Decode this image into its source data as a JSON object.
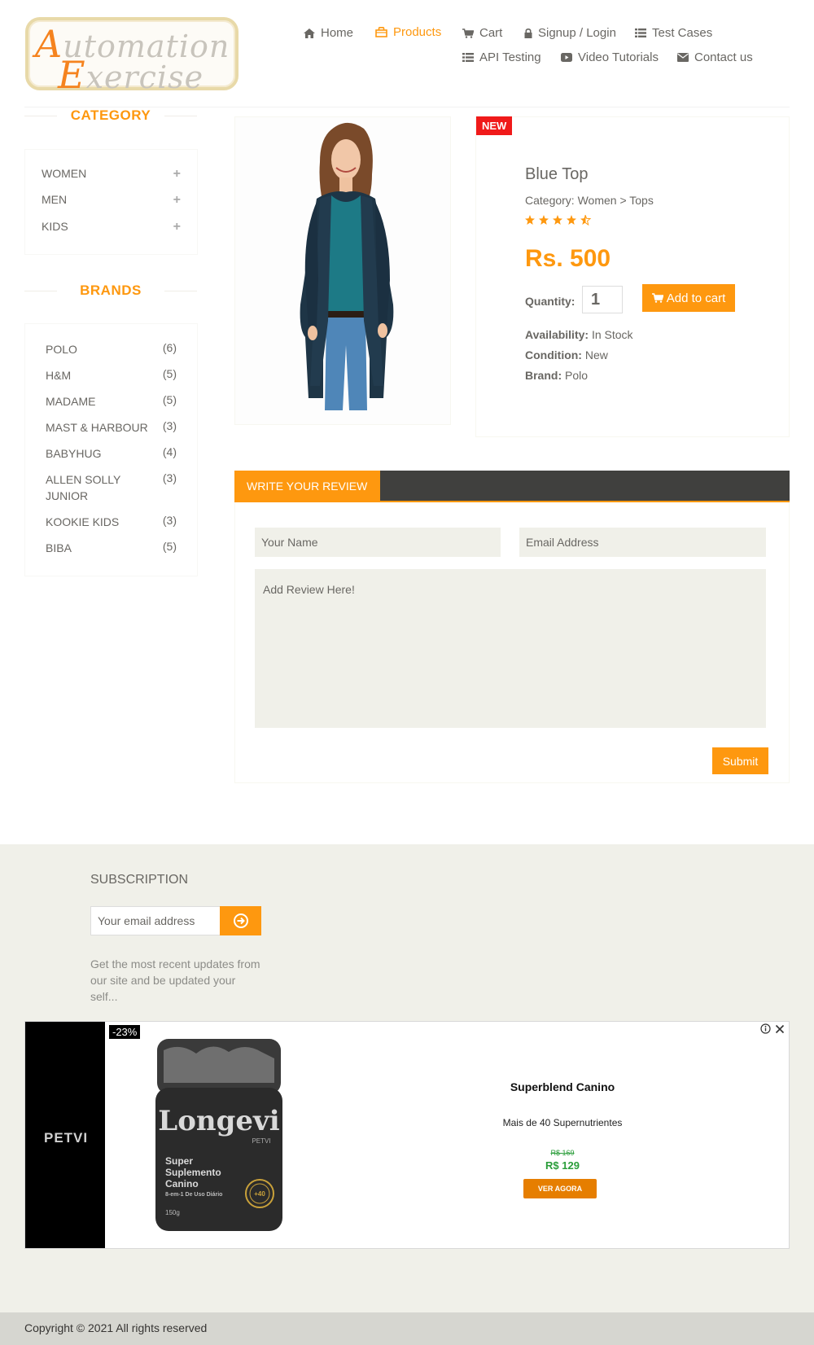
{
  "logo": {
    "line1_cap": "A",
    "line1_rest": "utomation",
    "line2_cap": "E",
    "line2_rest": "xercise"
  },
  "nav": {
    "home": "Home",
    "products": "Products",
    "cart": "Cart",
    "login": "Signup / Login",
    "test_cases": "Test Cases",
    "api_testing": "API Testing",
    "video_tutorials": "Video Tutorials",
    "contact": "Contact us"
  },
  "sidebar": {
    "category_title": "CATEGORY",
    "categories": [
      "Women",
      "Men",
      "Kids"
    ],
    "plus": "+",
    "brands_title": "BRANDS",
    "brands": [
      {
        "name": "Polo",
        "count": "(6)"
      },
      {
        "name": "H&M",
        "count": "(5)"
      },
      {
        "name": "Madame",
        "count": "(5)"
      },
      {
        "name": "Mast & Harbour",
        "count": "(3)"
      },
      {
        "name": "Babyhug",
        "count": "(4)"
      },
      {
        "name": "Allen Solly Junior",
        "count": "(3)"
      },
      {
        "name": "Kookie Kids",
        "count": "(3)"
      },
      {
        "name": "Biba",
        "count": "(5)"
      }
    ]
  },
  "product": {
    "badge": "NEW",
    "name": "Blue Top",
    "category": "Category: Women > Tops",
    "rating": 4.5,
    "price": "Rs. 500",
    "quantity_label": "Quantity:",
    "quantity_value": "1",
    "add_to_cart": "Add to cart",
    "availability_label": "Availability:",
    "availability_value": "In Stock",
    "condition_label": "Condition:",
    "condition_value": "New",
    "brand_label": "Brand:",
    "brand_value": "Polo"
  },
  "review": {
    "tab": "WRITE YOUR REVIEW",
    "name_placeholder": "Your Name",
    "email_placeholder": "Email Address",
    "review_placeholder": "Add Review Here!",
    "submit": "Submit"
  },
  "subscription": {
    "title": "SUBSCRIPTION",
    "placeholder": "Your email address",
    "text": "Get the most recent updates from our site and be updated your self..."
  },
  "ad": {
    "brand": "PETVI",
    "discount": "-23%",
    "jar_line1": "Longevi",
    "jar_line2": "PETVI",
    "jar_line3": "Super",
    "jar_line4": "Suplemento",
    "jar_line5": "Canino",
    "jar_line6": "8-em-1 De Uso Diário",
    "jar_line7": "150g",
    "jar_seal": "+40",
    "title": "Superblend Canino",
    "subtitle": "Mais de 40 Supernutrientes",
    "old_price": "R$ 169",
    "new_price": "R$ 129",
    "cta": "VER AGORA"
  },
  "footer": {
    "copyright": "Copyright © 2021 All rights reserved"
  },
  "colors": {
    "accent": "#fe980f",
    "badge_red": "#f01a1a",
    "footer_bg": "#f0f0e9",
    "review_bar": "#40403e",
    "price_green": "#2a9d3a"
  }
}
